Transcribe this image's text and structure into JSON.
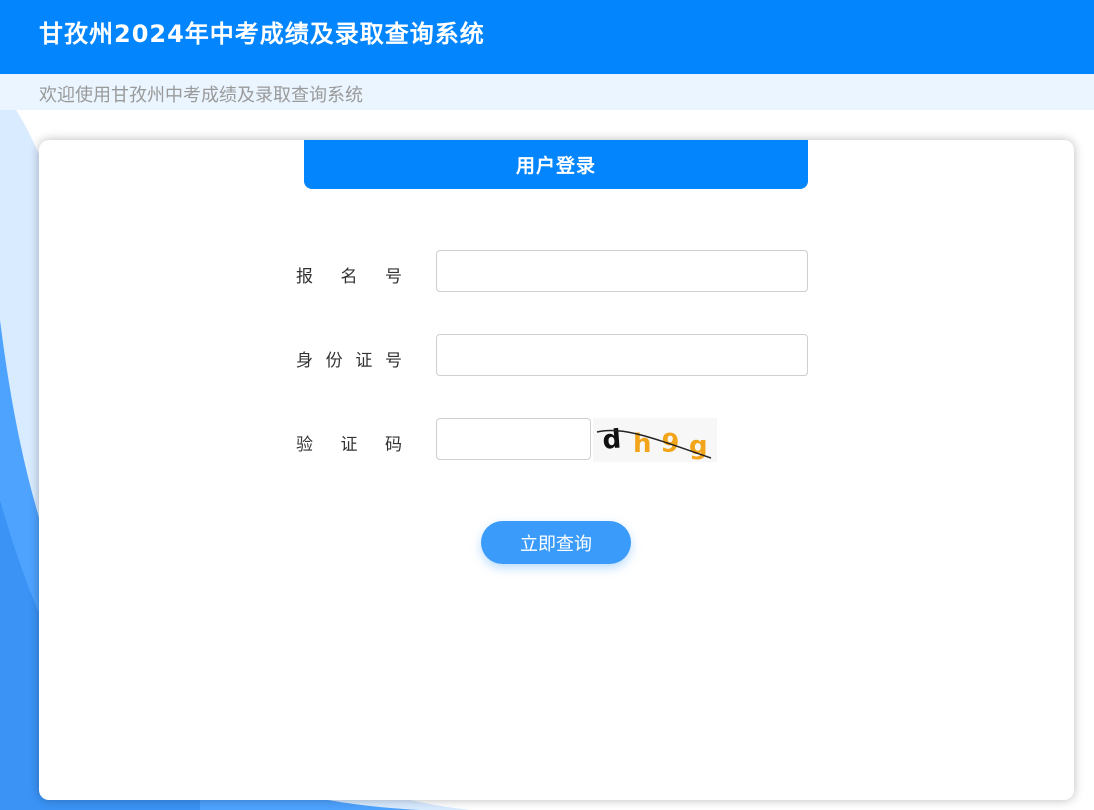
{
  "header": {
    "title": "甘孜州2024年中考成绩及录取查询系统"
  },
  "subbar": {
    "welcome": "欢迎使用甘孜州中考成绩及录取查询系统"
  },
  "login": {
    "tab_title": "用户登录",
    "fields": [
      {
        "label": "报名号",
        "value": "",
        "placeholder": ""
      },
      {
        "label": "身份证号",
        "value": "",
        "placeholder": ""
      },
      {
        "label": "验证码",
        "value": "",
        "placeholder": ""
      }
    ],
    "captcha_text": "d h 9 g",
    "submit_label": "立即查询"
  },
  "colors": {
    "primary": "#0385fd",
    "subbar_bg": "#eaf5ff",
    "button": "#3a9bfb",
    "background_curve": "#4ea3ff"
  }
}
